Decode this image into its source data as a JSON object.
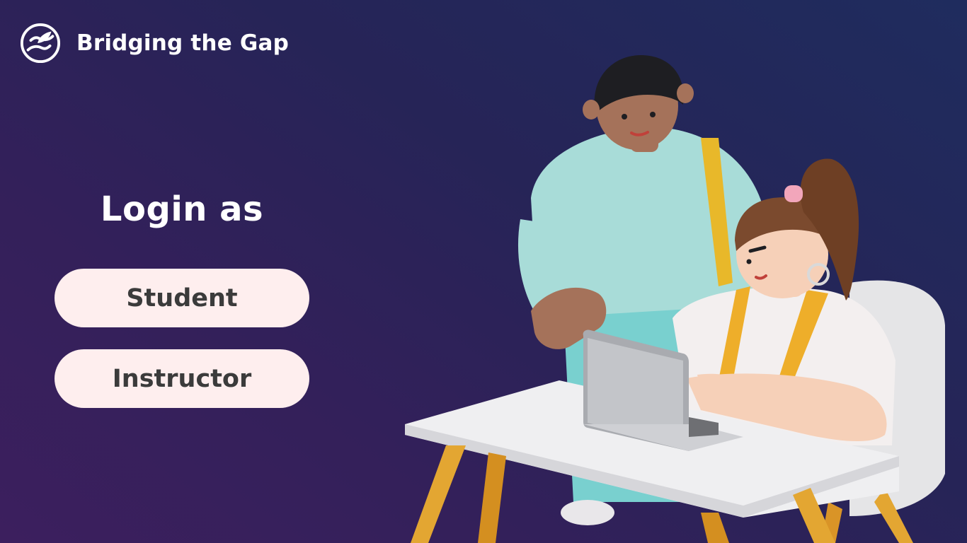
{
  "brand": {
    "name": "Bridging the Gap",
    "logo_icon": "hands-leaf-icon"
  },
  "login": {
    "title": "Login as",
    "options": [
      {
        "label": "Student"
      },
      {
        "label": "Instructor"
      }
    ]
  },
  "illustration": {
    "subject": "students-at-laptop-illustration"
  },
  "colors": {
    "background_start": "#3c1f5e",
    "background_end": "#1f2c5e",
    "button_bg": "#feeeee",
    "button_text": "#3b3b3b",
    "title_text": "#ffffff"
  }
}
